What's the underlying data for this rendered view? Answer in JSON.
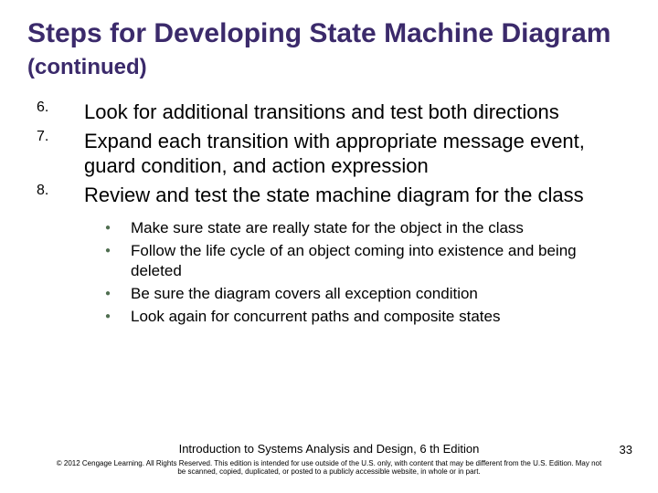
{
  "title_main": "Steps for Developing State Machine Diagram ",
  "title_cont": "(continued)",
  "steps": [
    {
      "n": "6.",
      "t": "Look for additional transitions and test both directions"
    },
    {
      "n": "7.",
      "t": "Expand each transition with appropriate message event, guard condition, and action expression"
    },
    {
      "n": "8.",
      "t": "Review and test the state machine diagram for the class"
    }
  ],
  "bullets": [
    "Make sure state are really state for the object in the class",
    "Follow the life cycle of an object coming into existence and being deleted",
    "Be sure the diagram covers all exception condition",
    "Look again for concurrent paths and composite states"
  ],
  "footer_book": "Introduction to Systems Analysis and Design, 6 th Edition",
  "footer_copy": "© 2012 Cengage Learning. All Rights Reserved. This edition is intended for use outside of the U.S. only, with content that may be different from the U.S. Edition. May not be scanned, copied, duplicated, or posted to a publicly accessible website, in whole or in part.",
  "page_number": "33"
}
